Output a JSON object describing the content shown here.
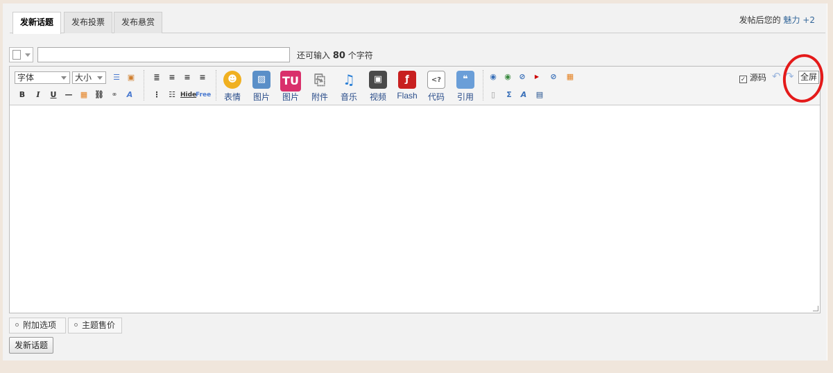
{
  "tabs": [
    {
      "label": "发新话题"
    },
    {
      "label": "发布投票"
    },
    {
      "label": "发布悬赏"
    }
  ],
  "charm": {
    "prefix": "发帖后您的",
    "attr": "魅力",
    "value": "+2"
  },
  "subject": {
    "value": "",
    "remain_prefix": "还可输入",
    "remain_count": "80",
    "remain_suffix": "个字符"
  },
  "toolbar": {
    "font_select": "字体",
    "size_select": "大小",
    "bold": "B",
    "italic": "I",
    "underline": "U",
    "hide": "Hide",
    "free": "Free",
    "buttons": [
      {
        "label": "表情",
        "icon": "smiley-icon",
        "color": "#f0b020"
      },
      {
        "label": "图片",
        "icon": "image-icon",
        "color": "#5a8fc8"
      },
      {
        "label": "图片",
        "icon": "tu-upload-icon",
        "color": "#d9306b",
        "glyph": "TU"
      },
      {
        "label": "附件",
        "icon": "paperclip-icon",
        "color": "#888"
      },
      {
        "label": "音乐",
        "icon": "music-icon",
        "color": "#2a7fd6"
      },
      {
        "label": "视频",
        "icon": "video-icon",
        "color": "#4a4a4a"
      },
      {
        "label": "Flash",
        "icon": "flash-icon",
        "color": "#c82020"
      },
      {
        "label": "代码",
        "icon": "code-icon",
        "color": "#999"
      },
      {
        "label": "引用",
        "icon": "quote-icon",
        "color": "#6a9ed8"
      }
    ],
    "source_label": "源码",
    "fullscreen_label": "全屏"
  },
  "editor": {
    "content": ""
  },
  "extras": [
    {
      "label": "附加选项"
    },
    {
      "label": "主题售价"
    }
  ],
  "submit_label": "发新话题",
  "accent_color": "#e41a1a"
}
